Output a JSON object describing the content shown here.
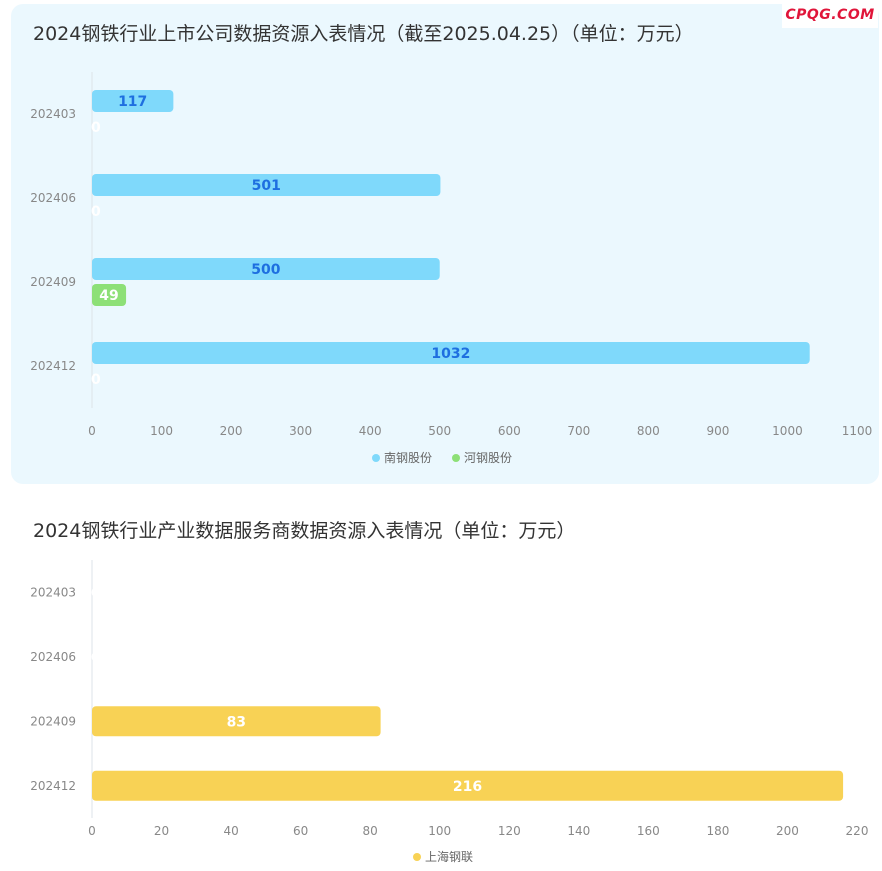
{
  "watermark": "CPQG.COM",
  "chart_data": [
    {
      "type": "bar",
      "orientation": "horizontal",
      "title": "2024钢铁行业上市公司数据资源入表情况（截至2025.04.25）（单位：万元）",
      "categories": [
        "202403",
        "202406",
        "202409",
        "202412"
      ],
      "series": [
        {
          "name": "南钢股份",
          "values": [
            117,
            501,
            500,
            1032
          ],
          "color": "#7fd9fb",
          "label_color": "#1e6fe0"
        },
        {
          "name": "河钢股份",
          "values": [
            0,
            0,
            49,
            0
          ],
          "color": "#8de077",
          "label_color": "#ffffff"
        }
      ],
      "xlim": [
        0,
        1100
      ],
      "xticks": [
        0,
        100,
        200,
        300,
        400,
        500,
        600,
        700,
        800,
        900,
        1000,
        1100
      ],
      "legend": "bottom-center",
      "grid": false
    },
    {
      "type": "bar",
      "orientation": "horizontal",
      "title": "2024钢铁行业产业数据服务商数据资源入表情况（单位：万元）",
      "categories": [
        "202403",
        "202406",
        "202409",
        "202412"
      ],
      "series": [
        {
          "name": "上海钢联",
          "values": [
            0,
            0,
            83,
            216
          ],
          "color": "#f8d255",
          "label_color": "#ffffff"
        }
      ],
      "xlim": [
        0,
        220
      ],
      "xticks": [
        0,
        20,
        40,
        60,
        80,
        100,
        120,
        140,
        160,
        180,
        200,
        220
      ],
      "legend": "bottom-center",
      "grid": false
    }
  ]
}
